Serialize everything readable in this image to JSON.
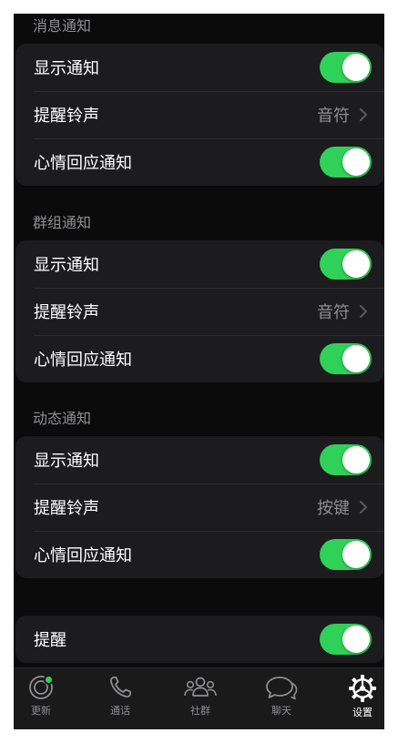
{
  "sections": [
    {
      "header": "消息通知",
      "rows": [
        {
          "label": "显示通知",
          "type": "toggle",
          "on": true
        },
        {
          "label": "提醒铃声",
          "type": "value",
          "value": "音符"
        },
        {
          "label": "心情回应通知",
          "type": "toggle",
          "on": true
        }
      ]
    },
    {
      "header": "群组通知",
      "rows": [
        {
          "label": "显示通知",
          "type": "toggle",
          "on": true
        },
        {
          "label": "提醒铃声",
          "type": "value",
          "value": "音符"
        },
        {
          "label": "心情回应通知",
          "type": "toggle",
          "on": true
        }
      ]
    },
    {
      "header": "动态通知",
      "rows": [
        {
          "label": "显示通知",
          "type": "toggle",
          "on": true
        },
        {
          "label": "提醒铃声",
          "type": "value",
          "value": "按键"
        },
        {
          "label": "心情回应通知",
          "type": "toggle",
          "on": true
        }
      ]
    }
  ],
  "reminder": {
    "label": "提醒",
    "type": "toggle",
    "on": true
  },
  "tabbar": {
    "tabs": [
      {
        "label": "更新",
        "icon": "updates-icon",
        "badge": true
      },
      {
        "label": "通话",
        "icon": "phone-icon"
      },
      {
        "label": "社群",
        "icon": "communities-icon"
      },
      {
        "label": "聊天",
        "icon": "chats-icon"
      },
      {
        "label": "设置",
        "icon": "gear-icon",
        "active": true
      }
    ]
  },
  "colors": {
    "accent": "#30d158",
    "background": "#0b0b0b",
    "group_background": "#1c1c1e",
    "secondary_text": "#8e8e93"
  }
}
